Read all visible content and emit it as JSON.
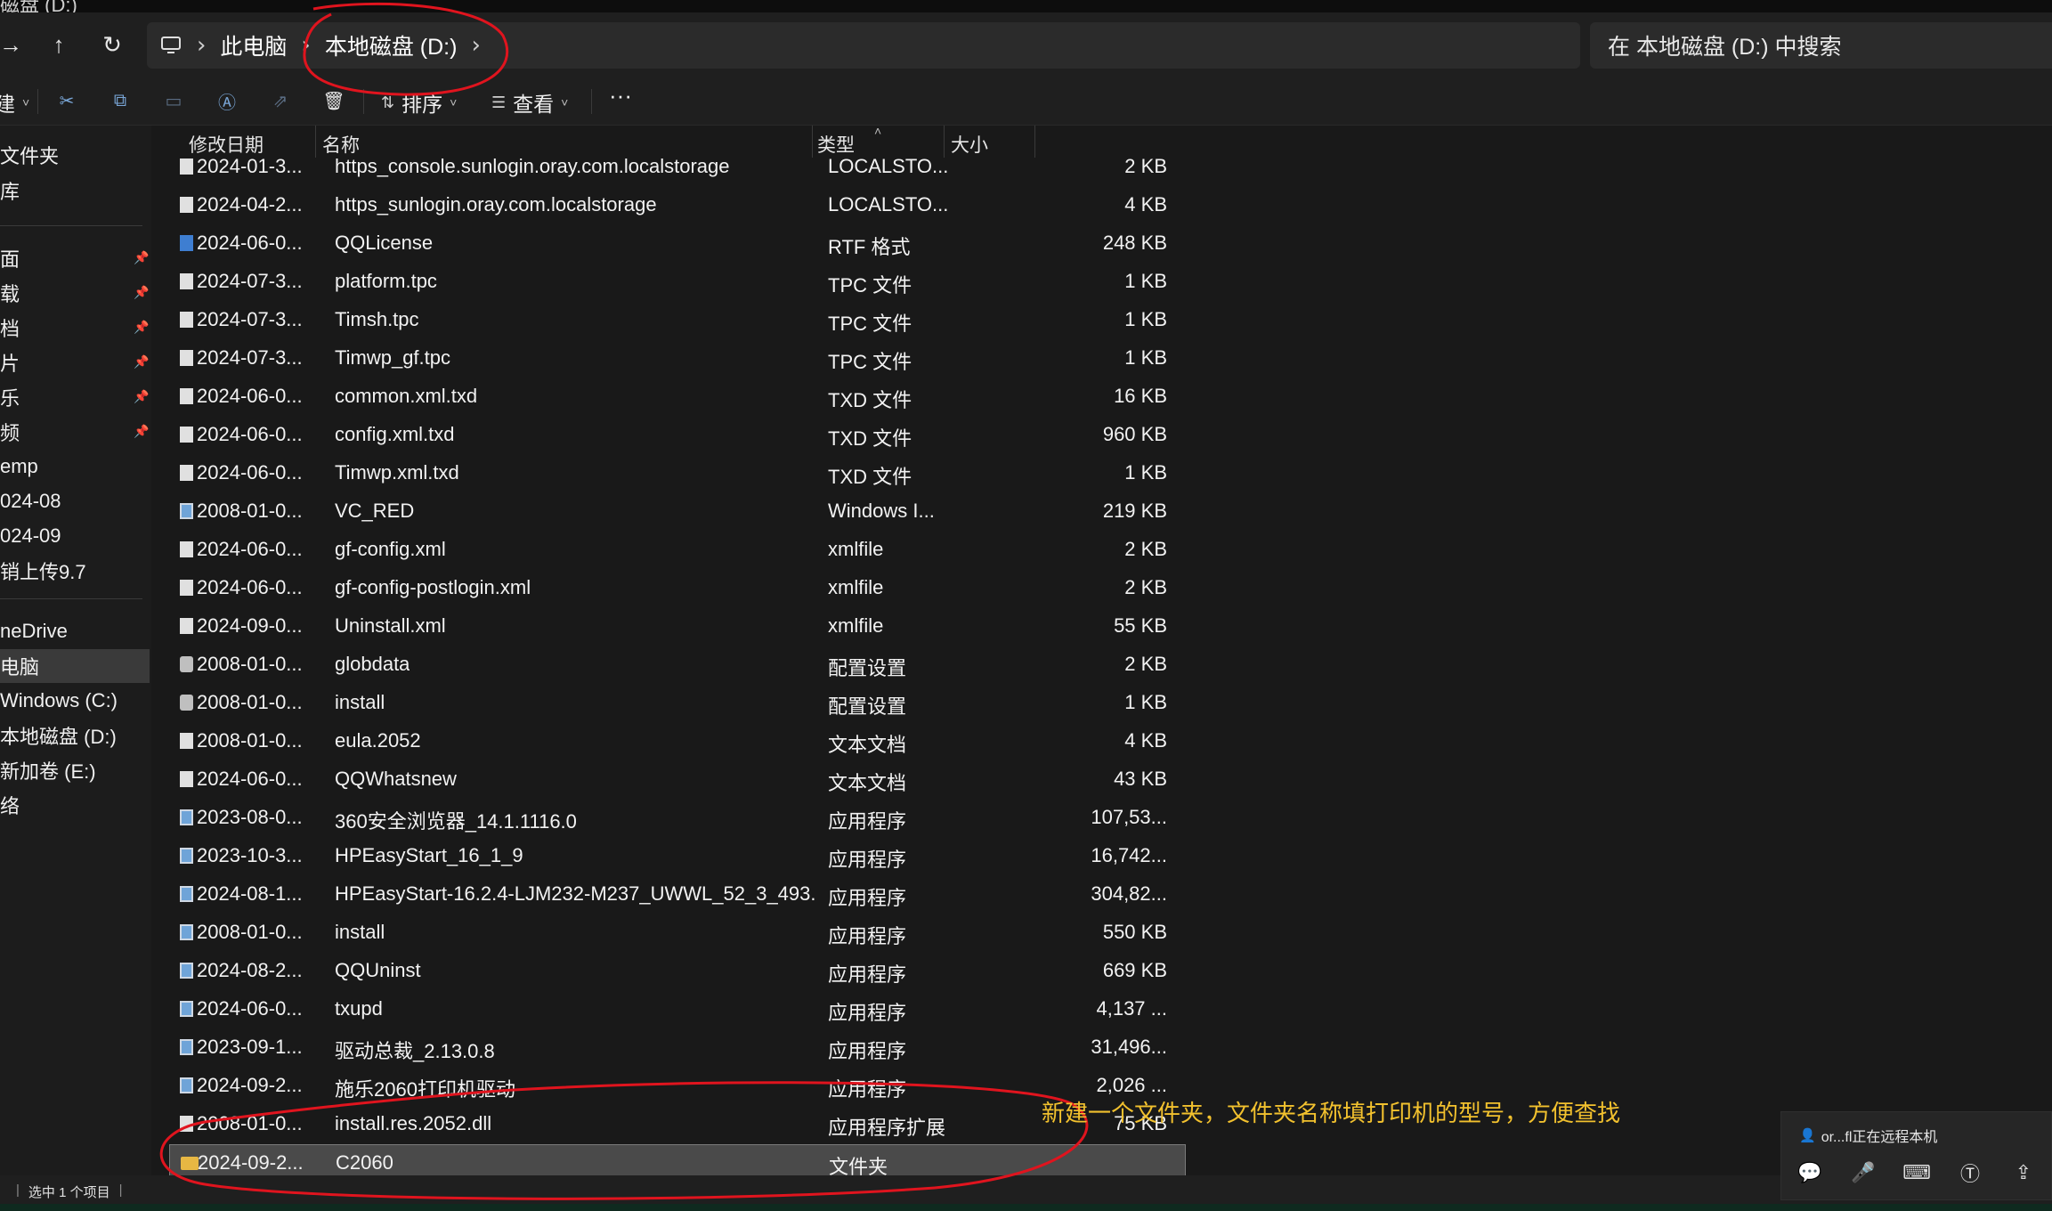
{
  "window": {
    "title_fragment": "磁盘 (D:)"
  },
  "nav": {
    "forward_icon": "arrow-right-icon",
    "up_icon": "arrow-up-icon",
    "refresh_icon": "refresh-icon"
  },
  "breadcrumb": {
    "items": [
      "此电脑",
      "本地磁盘 (D:)"
    ]
  },
  "search": {
    "placeholder": "在 本地磁盘 (D:) 中搜索"
  },
  "toolbar": {
    "new_fragment": "建",
    "sort_label": "排序",
    "view_label": "查看",
    "more_label": "···"
  },
  "sidebar": {
    "items": [
      {
        "label": "文件夹",
        "pinned": false
      },
      {
        "label": "库",
        "pinned": false
      },
      {
        "label": "面",
        "pinned": true
      },
      {
        "label": "载",
        "pinned": true
      },
      {
        "label": "档",
        "pinned": true
      },
      {
        "label": "片",
        "pinned": true
      },
      {
        "label": "乐",
        "pinned": true
      },
      {
        "label": "频",
        "pinned": true
      },
      {
        "label": "emp",
        "pinned": false
      },
      {
        "label": "024-08",
        "pinned": false
      },
      {
        "label": "024-09",
        "pinned": false
      },
      {
        "label": "销上传9.7",
        "pinned": false
      },
      {
        "label": "neDrive",
        "pinned": false
      },
      {
        "label": "电脑",
        "pinned": false,
        "selected": true
      },
      {
        "label": "Windows (C:)",
        "pinned": false
      },
      {
        "label": "本地磁盘 (D:)",
        "pinned": false
      },
      {
        "label": "新加卷 (E:)",
        "pinned": false
      },
      {
        "label": "络",
        "pinned": false
      }
    ]
  },
  "columns": {
    "date": "修改日期",
    "name": "名称",
    "type": "类型",
    "size": "大小"
  },
  "files": [
    {
      "date": "2024-01-3...",
      "name": "https_console.sunlogin.oray.com.localstorage",
      "type": "LOCALSTO...",
      "size": "2 KB",
      "icon": "doc"
    },
    {
      "date": "2024-04-2...",
      "name": "https_sunlogin.oray.com.localstorage",
      "type": "LOCALSTO...",
      "size": "4 KB",
      "icon": "doc"
    },
    {
      "date": "2024-06-0...",
      "name": "QQLicense",
      "type": "RTF 格式",
      "size": "248 KB",
      "icon": "rtf"
    },
    {
      "date": "2024-07-3...",
      "name": "platform.tpc",
      "type": "TPC 文件",
      "size": "1 KB",
      "icon": "doc"
    },
    {
      "date": "2024-07-3...",
      "name": "Timsh.tpc",
      "type": "TPC 文件",
      "size": "1 KB",
      "icon": "doc"
    },
    {
      "date": "2024-07-3...",
      "name": "Timwp_gf.tpc",
      "type": "TPC 文件",
      "size": "1 KB",
      "icon": "doc"
    },
    {
      "date": "2024-06-0...",
      "name": "common.xml.txd",
      "type": "TXD 文件",
      "size": "16 KB",
      "icon": "doc"
    },
    {
      "date": "2024-06-0...",
      "name": "config.xml.txd",
      "type": "TXD 文件",
      "size": "960 KB",
      "icon": "doc"
    },
    {
      "date": "2024-06-0...",
      "name": "Timwp.xml.txd",
      "type": "TXD 文件",
      "size": "1 KB",
      "icon": "doc"
    },
    {
      "date": "2008-01-0...",
      "name": "VC_RED",
      "type": "Windows I...",
      "size": "219 KB",
      "icon": "app"
    },
    {
      "date": "2024-06-0...",
      "name": "gf-config.xml",
      "type": "xmlfile",
      "size": "2 KB",
      "icon": "doc"
    },
    {
      "date": "2024-06-0...",
      "name": "gf-config-postlogin.xml",
      "type": "xmlfile",
      "size": "2 KB",
      "icon": "doc"
    },
    {
      "date": "2024-09-0...",
      "name": "Uninstall.xml",
      "type": "xmlfile",
      "size": "55 KB",
      "icon": "doc"
    },
    {
      "date": "2008-01-0...",
      "name": "globdata",
      "type": "配置设置",
      "size": "2 KB",
      "icon": "cfg"
    },
    {
      "date": "2008-01-0...",
      "name": "install",
      "type": "配置设置",
      "size": "1 KB",
      "icon": "cfg"
    },
    {
      "date": "2008-01-0...",
      "name": "eula.2052",
      "type": "文本文档",
      "size": "4 KB",
      "icon": "doc"
    },
    {
      "date": "2024-06-0...",
      "name": "QQWhatsnew",
      "type": "文本文档",
      "size": "43 KB",
      "icon": "doc"
    },
    {
      "date": "2023-08-0...",
      "name": "360安全浏览器_14.1.1116.0",
      "type": "应用程序",
      "size": "107,53...",
      "icon": "app"
    },
    {
      "date": "2023-10-3...",
      "name": "HPEasyStart_16_1_9",
      "type": "应用程序",
      "size": "16,742...",
      "icon": "app"
    },
    {
      "date": "2024-08-1...",
      "name": "HPEasyStart-16.2.4-LJM232-M237_UWWL_52_3_493...",
      "type": "应用程序",
      "size": "304,82...",
      "icon": "app"
    },
    {
      "date": "2008-01-0...",
      "name": "install",
      "type": "应用程序",
      "size": "550 KB",
      "icon": "app"
    },
    {
      "date": "2024-08-2...",
      "name": "QQUninst",
      "type": "应用程序",
      "size": "669 KB",
      "icon": "app"
    },
    {
      "date": "2024-06-0...",
      "name": "txupd",
      "type": "应用程序",
      "size": "4,137 ...",
      "icon": "app"
    },
    {
      "date": "2023-09-1...",
      "name": "驱动总裁_2.13.0.8",
      "type": "应用程序",
      "size": "31,496...",
      "icon": "app"
    },
    {
      "date": "2024-09-2...",
      "name": "施乐2060打印机驱动",
      "type": "应用程序",
      "size": "2,026 ...",
      "icon": "app"
    },
    {
      "date": "2008-01-0...",
      "name": "install.res.2052.dll",
      "type": "应用程序扩展",
      "size": "75 KB",
      "icon": "doc"
    },
    {
      "date": "2024-09-2...",
      "name": "C2060",
      "type": "文件夹",
      "size": "",
      "icon": "folder",
      "selected": true
    }
  ],
  "status": {
    "selection": "选中 1 个项目"
  },
  "annotation": {
    "text": "新建一个文件夹，文件夹名称填打印机的型号，方便查找"
  },
  "remote": {
    "label": "or...fl正在远程本机"
  },
  "colors": {
    "annotation": "#f2c12e",
    "ink": "#e0141e",
    "folder": "#e7b743",
    "accent": "#7aa7d8"
  }
}
